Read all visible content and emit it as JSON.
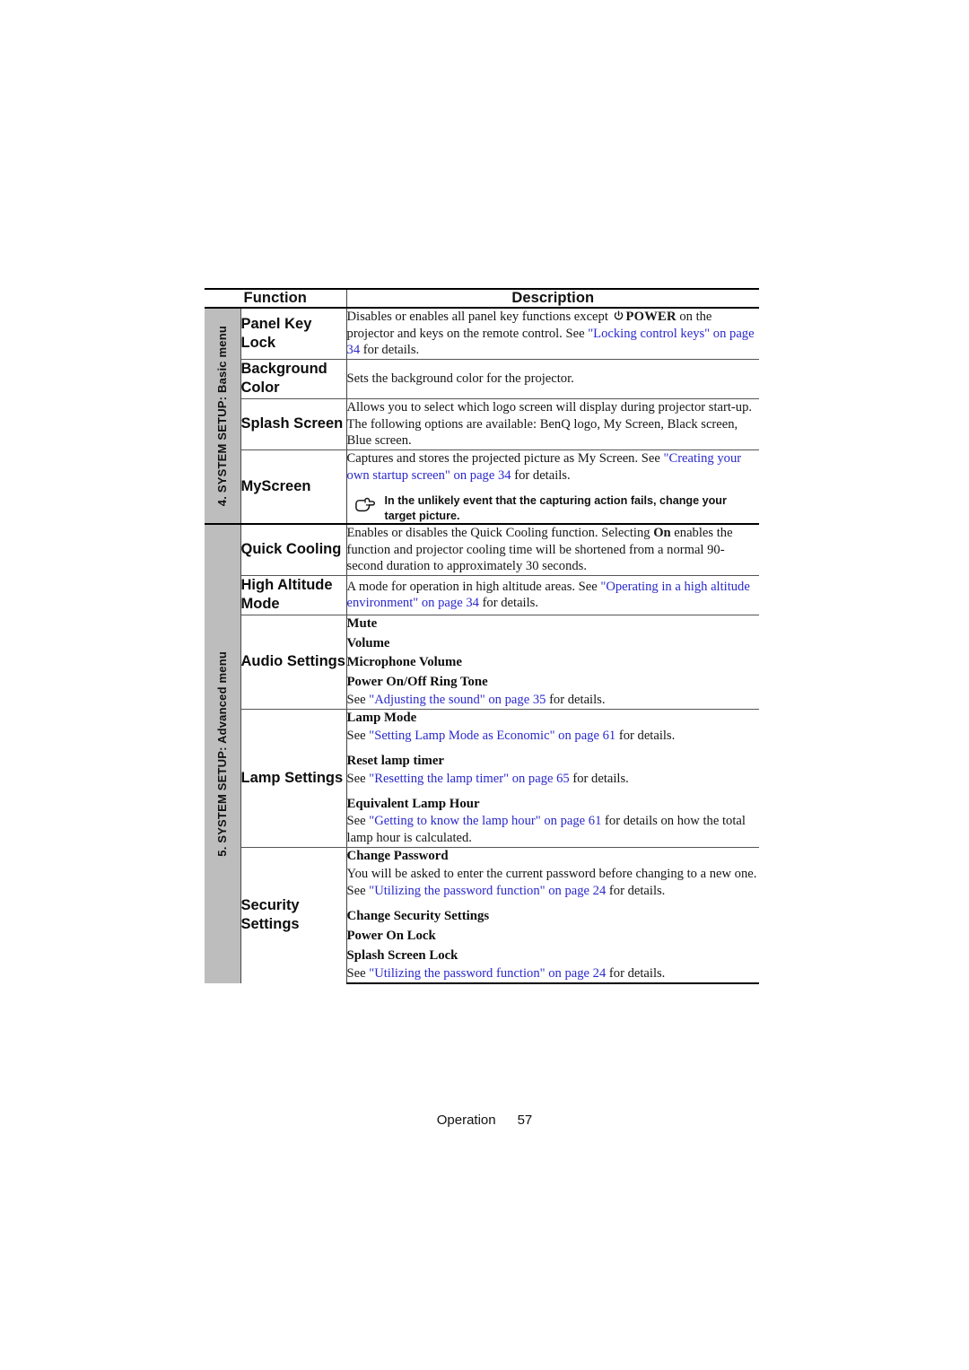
{
  "page": {
    "footer_label": "Operation",
    "footer_page_number": "57",
    "link_color": "#2a28cc",
    "sidebar_color": "#bdbdbd"
  },
  "table": {
    "headers": {
      "function": "Function",
      "description": "Description"
    },
    "sections": [
      {
        "sidebar_label": "4. SYSTEM SETUP: Basic menu",
        "rows": [
          {
            "function": "Panel Key Lock",
            "description_kind": "rich-power",
            "text_before_icon": "Disables or enables all panel key functions except ",
            "power_word": "POWER",
            "text_after_icon": " on the projector and keys on the remote control. See ",
            "link_1": "\"Locking control keys\" on page 34",
            "text_end": " for details."
          },
          {
            "function": "Background Color",
            "description_kind": "plain",
            "paragraph": "Sets the background color for the projector."
          },
          {
            "function": "Splash Screen",
            "description_kind": "plain",
            "paragraph": "Allows you to select which logo screen will display during projector start-up. The following options are available: BenQ logo, My Screen, Black screen, Blue screen."
          },
          {
            "function": "MyScreen",
            "description_kind": "link-plus-note",
            "text_before": "Captures and stores the projected picture as My Screen. See ",
            "link_1": "\"Creating your own startup screen\" on page 34",
            "text_end": " for details.",
            "note_icon": "pointing-hand-icon",
            "note_text": "In the unlikely event that the capturing action fails, change your target picture."
          }
        ]
      },
      {
        "sidebar_label": "5. SYSTEM SETUP: Advanced menu",
        "rows": [
          {
            "function": "Quick Cooling",
            "description_kind": "bold-on",
            "text_before": "Enables or disables the Quick Cooling function. Selecting ",
            "bold_word": "On",
            "text_after": " enables the function and projector cooling time will be shortened from a normal 90-second duration to approximately 30 seconds."
          },
          {
            "function": "High Altitude Mode",
            "description_kind": "link-only",
            "text_before": "A mode for operation in high altitude areas. See ",
            "link_1": "\"Operating in a high altitude environment\" on page 34",
            "text_end": " for details."
          },
          {
            "function": "Audio Settings",
            "description_kind": "sub-list",
            "groups": [
              {
                "heading": "Mute",
                "detail_before": "",
                "link": "",
                "detail_after": ""
              },
              {
                "heading": "Volume",
                "detail_before": "",
                "link": "",
                "detail_after": ""
              },
              {
                "heading": "Microphone Volume",
                "detail_before": "",
                "link": "",
                "detail_after": ""
              },
              {
                "heading": "Power On/Off Ring Tone",
                "detail_before": "See ",
                "link": "\"Adjusting the sound\" on page 35",
                "detail_after": " for details."
              }
            ]
          },
          {
            "function": "Lamp Settings",
            "description_kind": "sub-list",
            "groups": [
              {
                "heading": "Lamp Mode",
                "detail_before": "See ",
                "link": "\"Setting Lamp Mode as Economic\" on page 61",
                "detail_after": " for details."
              },
              {
                "heading": "Reset lamp timer",
                "detail_before": "See ",
                "link": "\"Resetting the lamp timer\" on page 65",
                "detail_after": " for details."
              },
              {
                "heading": "Equivalent Lamp Hour",
                "detail_before": "See ",
                "link": "\"Getting to know the lamp hour\" on page 61",
                "detail_after": " for details on how the total lamp hour is calculated."
              }
            ]
          },
          {
            "function": "Security Settings",
            "description_kind": "sub-list",
            "groups": [
              {
                "heading": "Change Password",
                "detail_before": "You will be asked to enter the current password before changing to a new one. See ",
                "link": "\"Utilizing the password function\" on page 24",
                "detail_after": " for details."
              },
              {
                "heading": "Change Security Settings",
                "detail_before": "",
                "link": "",
                "detail_after": ""
              },
              {
                "heading": "Power On Lock",
                "detail_before": "",
                "link": "",
                "detail_after": ""
              },
              {
                "heading": "Splash Screen Lock",
                "detail_before": "See ",
                "link": "\"Utilizing the password function\" on page 24",
                "detail_after": " for details."
              }
            ]
          }
        ]
      }
    ]
  }
}
